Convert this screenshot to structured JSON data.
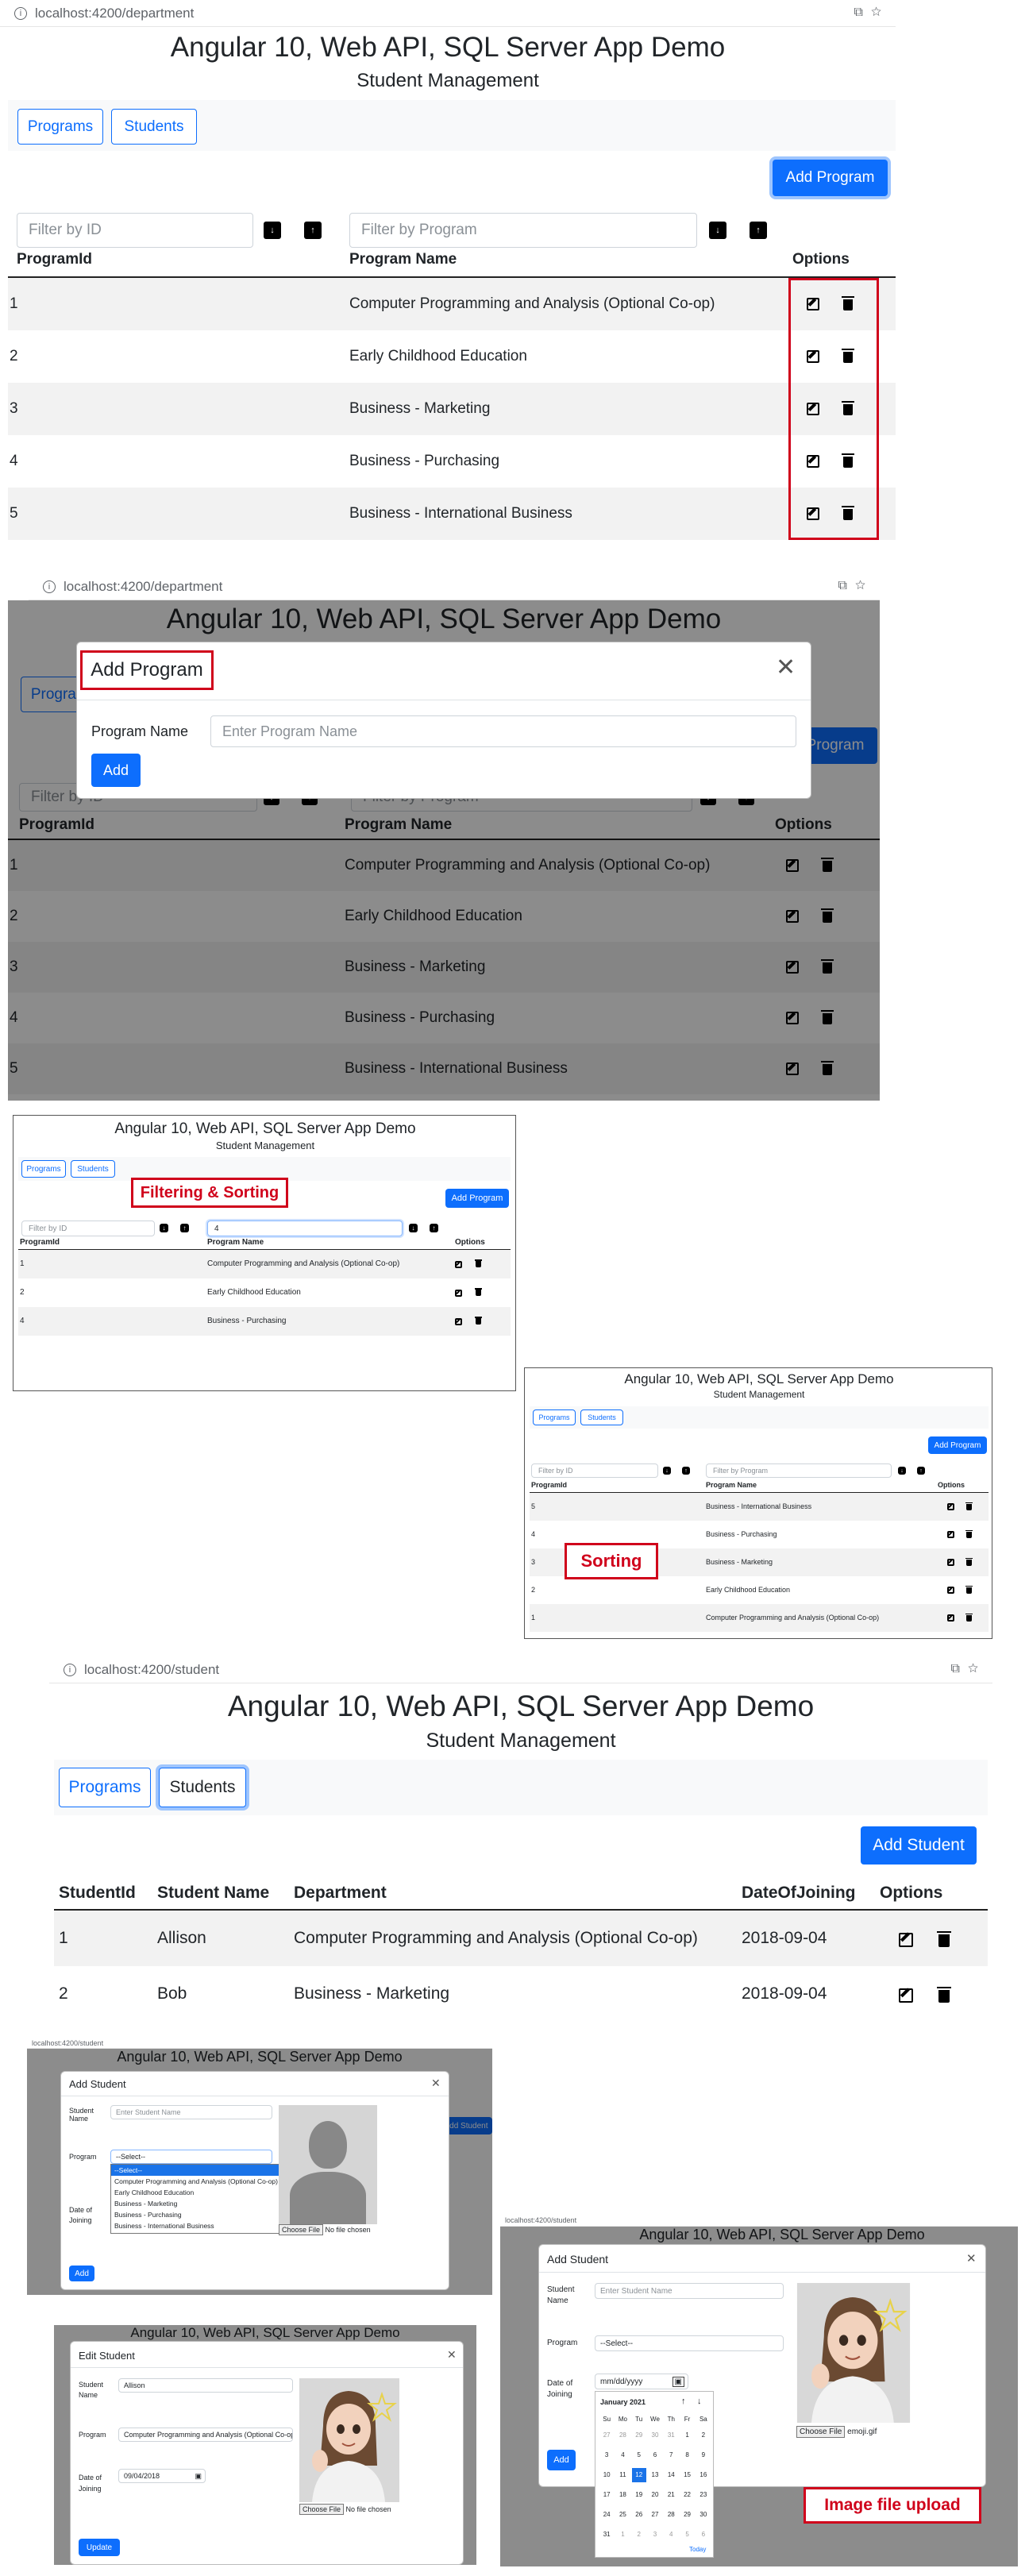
{
  "app": {
    "title": "Angular 10, Web API, SQL Server App Demo",
    "subtitle": "Student Management"
  },
  "urls": {
    "department": "localhost:4200/department",
    "student": "localhost:4200/student"
  },
  "nav": {
    "programs": "Programs",
    "students": "Students"
  },
  "program": {
    "add_button": "Add Program",
    "filter_id_placeholder": "Filter by ID",
    "filter_name_placeholder": "Filter by Program",
    "filter_name_typed": "4",
    "headers": {
      "id": "ProgramId",
      "name": "Program Name",
      "options": "Options"
    },
    "rows": [
      {
        "id": "1",
        "name": "Computer Programming and Analysis (Optional Co-op)"
      },
      {
        "id": "2",
        "name": "Early Childhood Education"
      },
      {
        "id": "3",
        "name": "Business - Marketing"
      },
      {
        "id": "4",
        "name": "Business - Purchasing"
      },
      {
        "id": "5",
        "name": "Business - International Business"
      }
    ],
    "filtered_rows": [
      {
        "id": "1",
        "name": "Computer Programming and Analysis (Optional Co-op)"
      },
      {
        "id": "2",
        "name": "Early Childhood Education"
      },
      {
        "id": "4",
        "name": "Business - Purchasing"
      }
    ],
    "sorted_rows": [
      {
        "id": "5",
        "name": "Business - International Business"
      },
      {
        "id": "4",
        "name": "Business - Purchasing"
      },
      {
        "id": "3",
        "name": "Business - Marketing"
      },
      {
        "id": "2",
        "name": "Early Childhood Education"
      },
      {
        "id": "1",
        "name": "Computer Programming and Analysis (Optional Co-op)"
      }
    ]
  },
  "add_program_modal": {
    "title": "Add Program",
    "label": "Program Name",
    "placeholder": "Enter Program Name",
    "button": "Add"
  },
  "callouts": {
    "filter_sort": "Filtering & Sorting",
    "sorting": "Sorting",
    "upload": "Image file upload"
  },
  "student": {
    "add_button": "Add Student",
    "headers": {
      "id": "StudentId",
      "name": "Student Name",
      "dept": "Department",
      "doj": "DateOfJoining",
      "options": "Options"
    },
    "rows": [
      {
        "id": "1",
        "name": "Allison",
        "dept": "Computer Programming and Analysis (Optional Co-op)",
        "doj": "2018-09-04"
      },
      {
        "id": "2",
        "name": "Bob",
        "dept": "Business - Marketing",
        "doj": "2018-09-04"
      }
    ]
  },
  "student_modal": {
    "add_title": "Add Student",
    "edit_title": "Edit Student",
    "name_label": "Student Name",
    "program_label": "Program",
    "date_label": "Date of Joining",
    "name_placeholder": "Enter Student Name",
    "select_default": "--Select--",
    "dropdown": [
      "--Select--",
      "Computer Programming and Analysis (Optional Co-op)",
      "Early Childhood Education",
      "Business - Marketing",
      "Business - Purchasing",
      "Business - International Business"
    ],
    "file_button": "Choose File",
    "no_file": "No file chosen",
    "chosen_file": "emoji.gif",
    "add_button": "Add",
    "update_button": "Update",
    "edit_name": "Allison",
    "edit_program": "Computer Programming and Analysis (Optional Co-op)",
    "edit_date": "09/04/2018",
    "date_placeholder": "mm/dd/yyyy"
  },
  "calendar": {
    "month": "January 2021",
    "weekdays": [
      "Su",
      "Mo",
      "Tu",
      "We",
      "Th",
      "Fr",
      "Sa"
    ],
    "days": [
      "27",
      "28",
      "29",
      "30",
      "31",
      "1",
      "2",
      "3",
      "4",
      "5",
      "6",
      "7",
      "8",
      "9",
      "10",
      "11",
      "12",
      "13",
      "14",
      "15",
      "16",
      "17",
      "18",
      "19",
      "20",
      "21",
      "22",
      "23",
      "24",
      "25",
      "26",
      "27",
      "28",
      "29",
      "30",
      "31",
      "1",
      "2",
      "3",
      "4",
      "5",
      "6"
    ],
    "selected": "12",
    "today": "Today"
  },
  "colors": {
    "primary": "#0d6efd",
    "callout": "#d0021b",
    "stripe": "#f2f2f2"
  }
}
